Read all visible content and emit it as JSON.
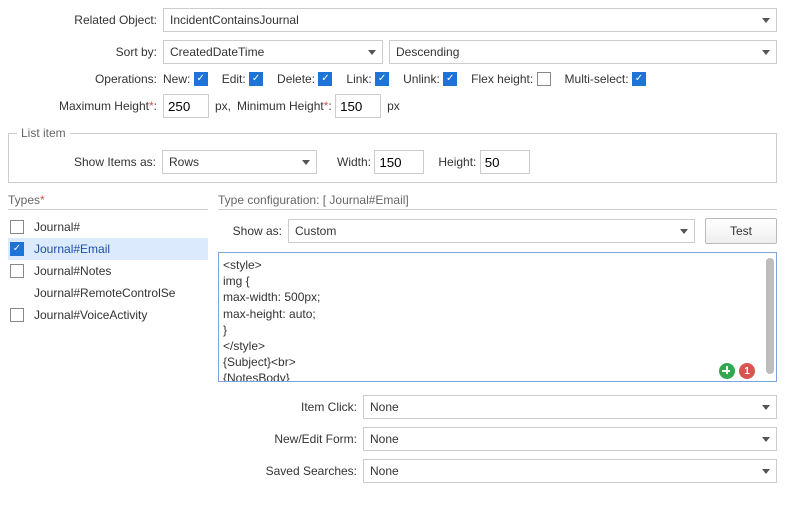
{
  "form": {
    "related_label": "Related Object:",
    "related_value": "IncidentContainsJournal",
    "sort_label": "Sort by:",
    "sort_field": "CreatedDateTime",
    "sort_dir": "Descending",
    "ops_label": "Operations:",
    "new": "New:",
    "edit": "Edit:",
    "delete": "Delete:",
    "link": "Link:",
    "unlink": "Unlink:",
    "flex": "Flex height:",
    "multi": "Multi-select:",
    "maxh_label": "Maximum Height",
    "maxh_val": "250",
    "px1": "px,",
    "minh_label": "Minimum Height",
    "minh_val": "150",
    "px2": "px"
  },
  "listitem": {
    "legend": "List item",
    "show_label": "Show Items as:",
    "show_value": "Rows",
    "width_label": "Width:",
    "width_val": "150",
    "height_label": "Height:",
    "height_val": "50"
  },
  "types": {
    "title": "Types",
    "items": [
      {
        "label": "Journal#"
      },
      {
        "label": "Journal#Email"
      },
      {
        "label": "Journal#Notes"
      },
      {
        "label": "Journal#RemoteControlSe"
      },
      {
        "label": "Journal#VoiceActivity"
      }
    ]
  },
  "config": {
    "title": "Type configuration: [ Journal#Email]",
    "showas_label": "Show as:",
    "showas_value": "Custom",
    "test_label": "Test",
    "editor_text": "<style>\nimg {\nmax-width: 500px;\nmax-height: auto;\n}\n</style>\n{Subject}<br>\n{NotesBody}\n</style>",
    "err_count": "1",
    "itemclick_label": "Item Click:",
    "neweditform_label": "New/Edit Form:",
    "savedsearch_label": "Saved Searches:",
    "none": "None"
  }
}
